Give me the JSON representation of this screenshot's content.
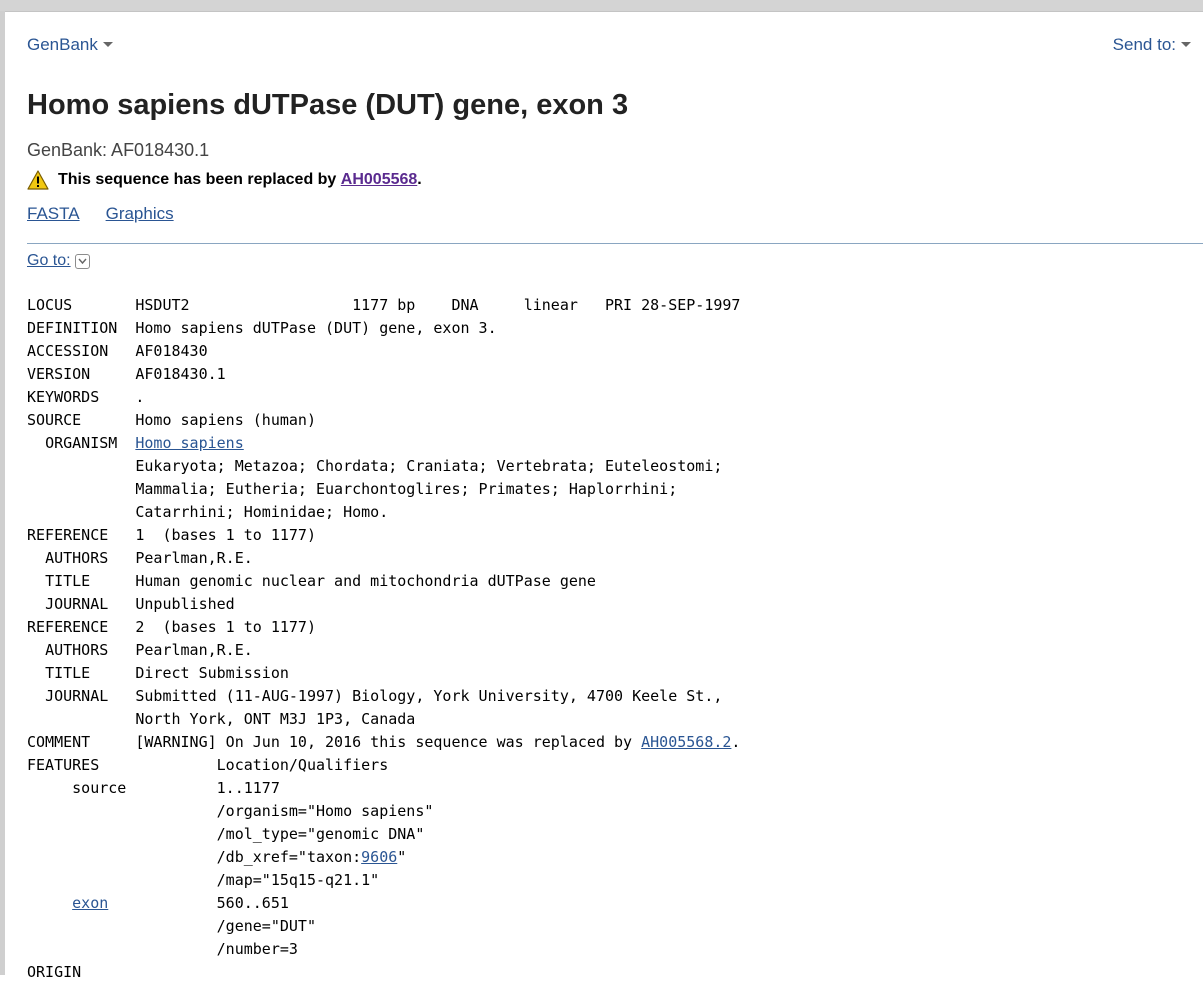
{
  "nav": {
    "database": "GenBank",
    "send_to": "Send to:"
  },
  "record": {
    "title": "Homo sapiens dUTPase (DUT) gene, exon 3",
    "accession_line": "GenBank: AF018430.1",
    "replaced_prefix": "This sequence has been replaced by",
    "replaced_link": "AH005568",
    "replaced_suffix": "."
  },
  "formats": {
    "fasta": "FASTA",
    "graphics": "Graphics"
  },
  "goto": "Go to:",
  "flatfile": {
    "locus_key": "LOCUS",
    "locus_val": "HSDUT2                  1177 bp    DNA     linear   PRI 28-SEP-1997",
    "definition_key": "DEFINITION",
    "definition_val": "Homo sapiens dUTPase (DUT) gene, exon 3.",
    "accession_key": "ACCESSION",
    "accession_val": "AF018430",
    "version_key": "VERSION",
    "version_val": "AF018430.1",
    "keywords_key": "KEYWORDS",
    "keywords_val": ".",
    "source_key": "SOURCE",
    "source_val": "Homo sapiens (human)",
    "organism_key": "ORGANISM",
    "organism_link": "Homo sapiens",
    "lineage": [
      "Eukaryota; Metazoa; Chordata; Craniata; Vertebrata; Euteleostomi;",
      "Mammalia; Eutheria; Euarchontoglires; Primates; Haplorrhini;",
      "Catarrhini; Hominidae; Homo."
    ],
    "references": [
      {
        "key": "REFERENCE",
        "val": "1  (bases 1 to 1177)",
        "authors_key": "AUTHORS",
        "authors": "Pearlman,R.E.",
        "title_key": "TITLE",
        "title": "Human genomic nuclear and mitochondria dUTPase gene",
        "journal_key": "JOURNAL",
        "journal": "Unpublished"
      },
      {
        "key": "REFERENCE",
        "val": "2  (bases 1 to 1177)",
        "authors_key": "AUTHORS",
        "authors": "Pearlman,R.E.",
        "title_key": "TITLE",
        "title": "Direct Submission",
        "journal_key": "JOURNAL",
        "journal": "Submitted (11-AUG-1997) Biology, York University, 4700 Keele St.,",
        "journal_cont": "North York, ONT M3J 1P3, Canada"
      }
    ],
    "comment_key": "COMMENT",
    "comment_prefix": "[WARNING] On Jun 10, 2016 this sequence was replaced by",
    "comment_link": "AH005568.2",
    "comment_suffix": ".",
    "features_key": "FEATURES",
    "features_header": "Location/Qualifiers",
    "source_feature_key": "source",
    "source_feature_loc": "1..1177",
    "q_organism": "/organism=\"Homo sapiens\"",
    "q_moltype": "/mol_type=\"genomic DNA\"",
    "q_dbxref_prefix": "/db_xref=\"taxon:",
    "q_dbxref_link": "9606",
    "q_dbxref_suffix": "\"",
    "q_map": "/map=\"15q15-q21.1\"",
    "exon_feature_key": "exon",
    "exon_loc": "560..651",
    "q_gene": "/gene=\"DUT\"",
    "q_number": "/number=3",
    "origin_key": "ORIGIN"
  }
}
